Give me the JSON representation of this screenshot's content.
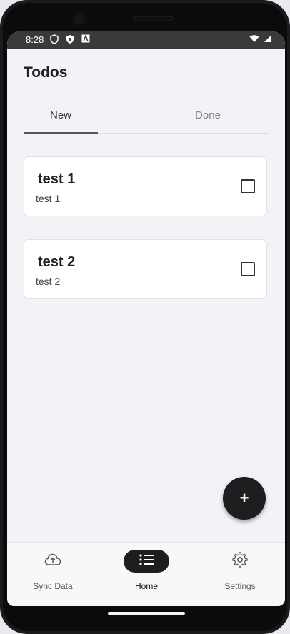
{
  "status": {
    "time": "8:28",
    "left_icons": [
      "shield-icon",
      "privacy-shield-icon",
      "a-box-icon"
    ],
    "right_icons": [
      "wifi-icon",
      "signal-icon"
    ]
  },
  "appbar": {
    "title": "Todos"
  },
  "tabs": [
    {
      "label": "New",
      "selected": true
    },
    {
      "label": "Done",
      "selected": false
    }
  ],
  "todos": [
    {
      "title": "test 1",
      "subtitle": "test 1",
      "checked": false
    },
    {
      "title": "test 2",
      "subtitle": "test 2",
      "checked": false
    }
  ],
  "fab": {
    "label": "+"
  },
  "bottom_nav": [
    {
      "label": "Sync Data",
      "icon": "cloud-upload-icon",
      "active": false
    },
    {
      "label": "Home",
      "icon": "list-icon",
      "active": true
    },
    {
      "label": "Settings",
      "icon": "gear-icon",
      "active": false
    }
  ],
  "colors": {
    "accent": "#1e1e20",
    "surface": "#f3f3f7",
    "card": "#ffffff"
  }
}
